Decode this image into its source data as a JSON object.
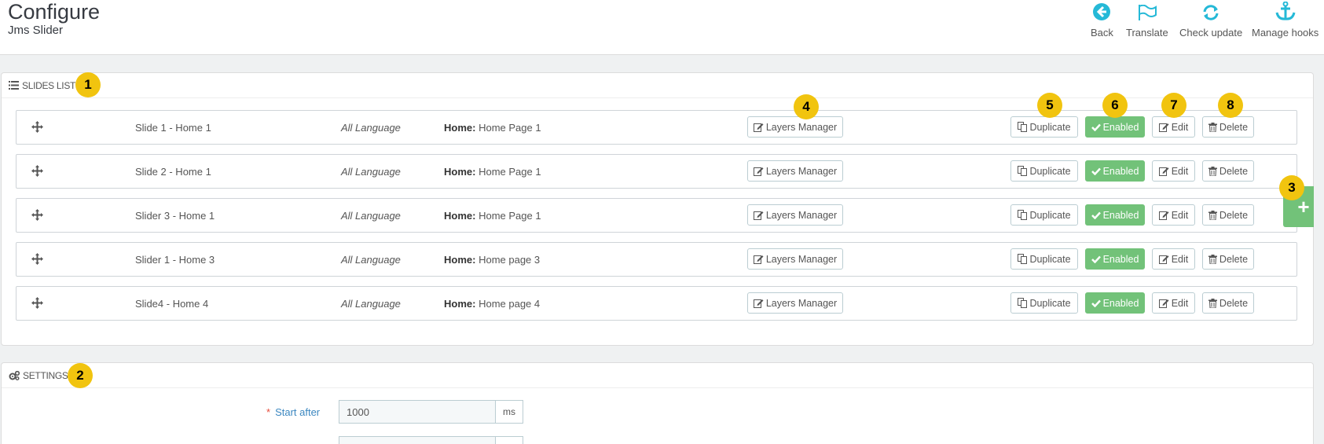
{
  "header": {
    "title": "Configure",
    "subtitle": "Jms Slider",
    "toolbar": [
      {
        "label": "Back",
        "icon": "back-arrow-icon"
      },
      {
        "label": "Translate",
        "icon": "flag-icon"
      },
      {
        "label": "Check update",
        "icon": "refresh-icon"
      },
      {
        "label": "Manage hooks",
        "icon": "anchor-icon"
      }
    ]
  },
  "slides_panel": {
    "title": "SLIDES LIST",
    "icon": "list-icon",
    "rows": [
      {
        "name": "Slide 1 - Home 1",
        "language": "All Language",
        "home_label": "Home:",
        "home_value": "Home Page 1",
        "status": "Enabled"
      },
      {
        "name": "Slide 2 - Home 1",
        "language": "All Language",
        "home_label": "Home:",
        "home_value": "Home Page 1",
        "status": "Enabled"
      },
      {
        "name": "Slider 3 - Home 1",
        "language": "All Language",
        "home_label": "Home:",
        "home_value": "Home Page 1",
        "status": "Enabled"
      },
      {
        "name": "Slider 1 - Home 3",
        "language": "All Language",
        "home_label": "Home:",
        "home_value": "Home page 3",
        "status": "Enabled"
      },
      {
        "name": "Slide4 - Home 4",
        "language": "All Language",
        "home_label": "Home:",
        "home_value": "Home page 4",
        "status": "Enabled"
      }
    ],
    "buttons": {
      "layers": "Layers Manager",
      "duplicate": "Duplicate",
      "enabled": "Enabled",
      "edit": "Edit",
      "delete": "Delete"
    },
    "add_label": "+"
  },
  "settings_panel": {
    "title": "SETTINGS",
    "icon": "cogs-icon",
    "fields": [
      {
        "label": "Start after",
        "required": "*",
        "value": "1000",
        "unit": "ms"
      }
    ]
  },
  "badges": [
    "1",
    "2",
    "3",
    "4",
    "5",
    "6",
    "7",
    "8"
  ],
  "colors": {
    "accent": "#25b9d7",
    "enabled": "#72c279",
    "badge": "#f1c40f",
    "label": "#3b87c0"
  }
}
